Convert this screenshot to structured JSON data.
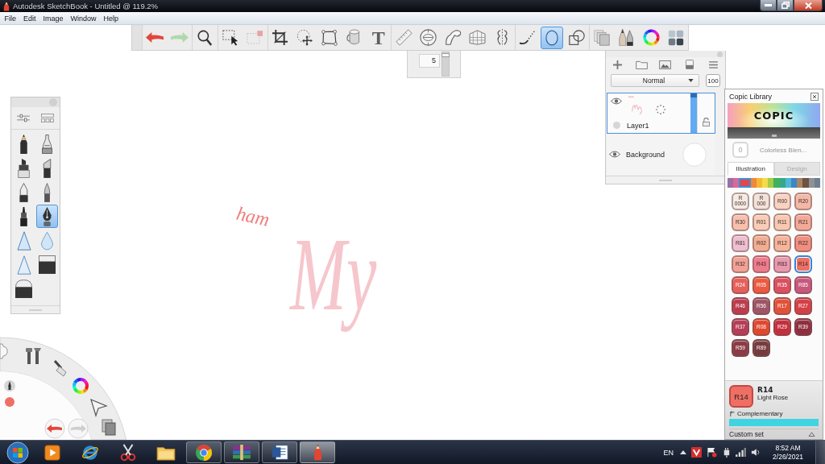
{
  "window": {
    "title": "Autodesk SketchBook - Untitled @ 119.2%"
  },
  "menu": [
    {
      "label": "File"
    },
    {
      "label": "Edit"
    },
    {
      "label": "Image"
    },
    {
      "label": "Window"
    },
    {
      "label": "Help"
    }
  ],
  "toolbar": {
    "tools": [
      {
        "kind": "undo",
        "selected": false,
        "disabled": false
      },
      {
        "kind": "redo",
        "selected": false,
        "disabled": true
      },
      {
        "kind": "zoom",
        "selected": false,
        "disabled": false
      },
      {
        "kind": "select",
        "selected": false,
        "disabled": false
      },
      {
        "kind": "select-clear",
        "selected": false,
        "disabled": true
      },
      {
        "kind": "crop",
        "selected": false,
        "disabled": false
      },
      {
        "kind": "move",
        "selected": false,
        "disabled": false
      },
      {
        "kind": "distort",
        "selected": false,
        "disabled": false
      },
      {
        "kind": "fill",
        "selected": false,
        "disabled": false
      },
      {
        "kind": "text",
        "label": "T",
        "selected": false,
        "disabled": false
      },
      {
        "kind": "ruler",
        "selected": false,
        "disabled": false
      },
      {
        "kind": "ellipse-guide",
        "selected": false,
        "disabled": false
      },
      {
        "kind": "french-curve",
        "selected": false,
        "disabled": false
      },
      {
        "kind": "perspective",
        "selected": false,
        "disabled": false
      },
      {
        "kind": "symmetry",
        "selected": false,
        "disabled": false
      },
      {
        "kind": "stroke",
        "selected": false,
        "disabled": false
      },
      {
        "kind": "ellipse",
        "selected": true,
        "disabled": false
      },
      {
        "kind": "shapes",
        "selected": false,
        "disabled": false
      },
      {
        "kind": "copy",
        "selected": false,
        "disabled": false
      },
      {
        "kind": "brushes",
        "selected": false,
        "disabled": false
      },
      {
        "kind": "color-wheel",
        "selected": false,
        "disabled": false
      },
      {
        "kind": "copic",
        "selected": false,
        "disabled": false
      }
    ]
  },
  "brush_size": {
    "value": "5",
    "level": 0.97
  },
  "brush_palette": {
    "brushes": [
      {
        "kind": "pencil",
        "selected": false
      },
      {
        "kind": "airbrush",
        "selected": false
      },
      {
        "kind": "marker",
        "selected": false
      },
      {
        "kind": "chisel",
        "selected": false
      },
      {
        "kind": "pen",
        "selected": false
      },
      {
        "kind": "brush-pen",
        "selected": false
      },
      {
        "kind": "felt-pen",
        "selected": false
      },
      {
        "kind": "nib",
        "selected": true
      },
      {
        "kind": "hard-triangle",
        "selected": false
      },
      {
        "kind": "blender",
        "selected": false
      },
      {
        "kind": "soft-triangle",
        "selected": false
      },
      {
        "kind": "hard-eraser",
        "selected": false
      },
      {
        "kind": "soft-eraser",
        "selected": false
      }
    ]
  },
  "canvas": {
    "strokes": [
      {
        "text": "ham",
        "color": "#f07c7c"
      },
      {
        "text": "My",
        "color": "#f6c6cd"
      }
    ]
  },
  "layers": {
    "blend_mode": "Normal",
    "opacity": "100",
    "items": [
      {
        "kind": "layer",
        "name": "Layer1",
        "selected": true,
        "visible": true
      },
      {
        "kind": "background",
        "name": "Background",
        "selected": false,
        "visible": true
      }
    ]
  },
  "copic_library": {
    "title": "Copic Library",
    "logo": "COPIC",
    "blender": {
      "code": "0",
      "name": "Colorless Blen...",
      "disabled": true
    },
    "tabs": [
      {
        "label": "Illustration",
        "selected": true
      },
      {
        "label": "Design",
        "selected": false
      }
    ],
    "families": [
      {
        "color": "#9a6fa6",
        "selected": false
      },
      {
        "color": "#d86a98",
        "selected": false
      },
      {
        "color": "#e0484e",
        "selected": true
      },
      {
        "color": "#f0873a",
        "selected": false
      },
      {
        "color": "#f5b833",
        "selected": false
      },
      {
        "color": "#f2dc4a",
        "selected": false
      },
      {
        "color": "#a8cc44",
        "selected": false
      },
      {
        "color": "#3eb25e",
        "selected": false
      },
      {
        "color": "#35a88a",
        "selected": false
      },
      {
        "color": "#4fb6d6",
        "selected": false
      },
      {
        "color": "#3d86c8",
        "selected": false
      },
      {
        "color": "#a98560",
        "selected": false
      },
      {
        "color": "#6e5342",
        "selected": false
      },
      {
        "color": "#8c9296",
        "selected": false
      },
      {
        "color": "#6f7f92",
        "selected": false
      }
    ],
    "swatches": [
      {
        "label": "R 0000",
        "color": "#f6ebe3",
        "selected": false
      },
      {
        "label": "R 000",
        "color": "#f3e2d9",
        "selected": false
      },
      {
        "label": "R00",
        "color": "#f8d3c2",
        "selected": false
      },
      {
        "label": "R20",
        "color": "#f4b8a6",
        "selected": false
      },
      {
        "label": "R30",
        "color": "#f6c0ad",
        "selected": false
      },
      {
        "label": "R01",
        "color": "#f8cdb7",
        "selected": false
      },
      {
        "label": "R11",
        "color": "#f7c9b1",
        "selected": false
      },
      {
        "label": "R21",
        "color": "#f3a997",
        "selected": false
      },
      {
        "label": "R81",
        "color": "#eebfd0",
        "selected": false
      },
      {
        "label": "R02",
        "color": "#f2ae93",
        "selected": false
      },
      {
        "label": "R12",
        "color": "#f5b49b",
        "selected": false
      },
      {
        "label": "R22",
        "color": "#f08e80",
        "selected": false
      },
      {
        "label": "R32",
        "color": "#f2a295",
        "selected": false
      },
      {
        "label": "R43",
        "color": "#ee7b8c",
        "selected": false
      },
      {
        "label": "R83",
        "color": "#e999ae",
        "selected": false
      },
      {
        "label": "R14",
        "color": "#ef6f64",
        "selected": true
      },
      {
        "label": "R24",
        "color": "#e6605a",
        "selected": false
      },
      {
        "label": "R05",
        "color": "#eb5a3f",
        "selected": false
      },
      {
        "label": "R35",
        "color": "#dc4f5e",
        "selected": false
      },
      {
        "label": "R85",
        "color": "#c9577d",
        "selected": false
      },
      {
        "label": "R46",
        "color": "#bc3c4e",
        "selected": false
      },
      {
        "label": "R56",
        "color": "#9e5565",
        "selected": false
      },
      {
        "label": "R17",
        "color": "#e25039",
        "selected": false
      },
      {
        "label": "R27",
        "color": "#d43f46",
        "selected": false
      },
      {
        "label": "R37",
        "color": "#b53d55",
        "selected": false
      },
      {
        "label": "R08",
        "color": "#e0482e",
        "selected": false
      },
      {
        "label": "R29",
        "color": "#c42f3c",
        "selected": false
      },
      {
        "label": "R39",
        "color": "#8f2e3e",
        "selected": false
      },
      {
        "label": "R59",
        "color": "#8a3b43",
        "selected": false
      },
      {
        "label": "R89",
        "color": "#773b3d",
        "selected": false
      }
    ],
    "current": {
      "swatch_label": "R14",
      "code": "R14",
      "name": "Light Rose"
    },
    "complementary": "Complementary",
    "custom_set": "Custom set"
  },
  "taskbar": {
    "apps": [
      {
        "kind": "play",
        "running": false,
        "selected": false
      },
      {
        "kind": "browser-e",
        "running": false,
        "selected": false
      },
      {
        "kind": "scissors",
        "running": false,
        "selected": false
      },
      {
        "kind": "folder",
        "running": false,
        "selected": false
      },
      {
        "kind": "browser-round",
        "running": true,
        "selected": false
      },
      {
        "kind": "archive",
        "running": true,
        "selected": false
      },
      {
        "kind": "document",
        "running": true,
        "selected": false
      },
      {
        "kind": "pencil",
        "running": true,
        "selected": true
      }
    ],
    "language": "EN",
    "time": "8:52 AM",
    "date": "2/26/2021"
  }
}
